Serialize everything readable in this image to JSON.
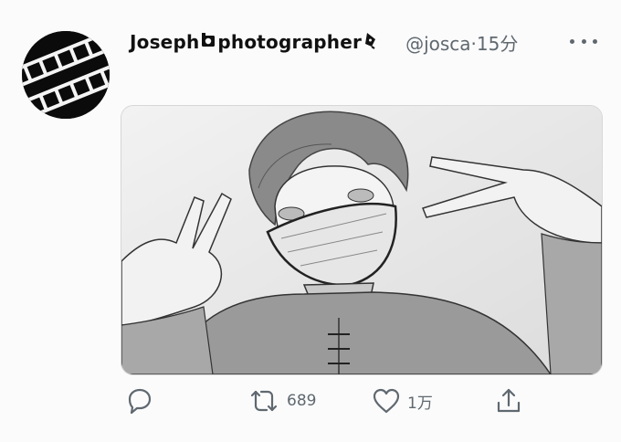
{
  "tweet": {
    "author": {
      "name": "Joseph",
      "role": "photographer",
      "handle": "@josca",
      "separator": "·",
      "time": "15分"
    },
    "icons": {
      "name_icon_1": "camera-icon",
      "name_icon_2": "pen-nib-icon",
      "more": "more-icon",
      "reply": "reply-icon",
      "retweet": "retweet-icon",
      "like": "heart-icon",
      "share": "share-icon"
    },
    "stats": {
      "retweets": "689",
      "likes": "1万"
    },
    "colors": {
      "text": "#111111",
      "muted": "#5f6870",
      "background": "#fbfbfb"
    }
  }
}
